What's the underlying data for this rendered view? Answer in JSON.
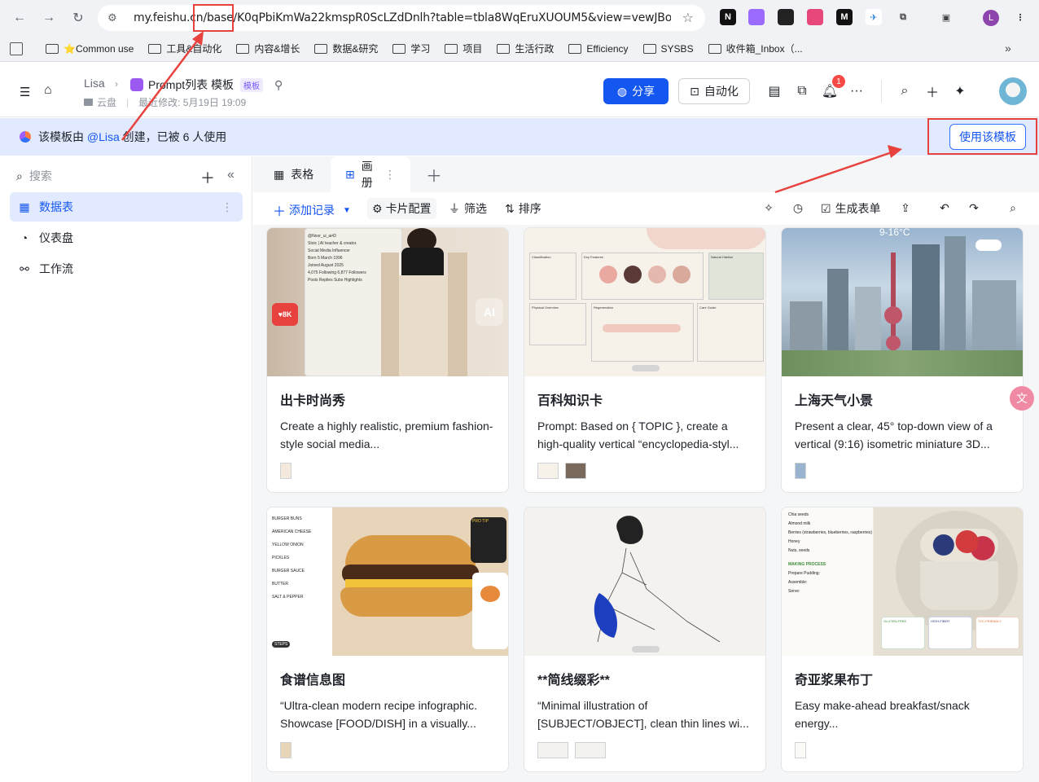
{
  "browser": {
    "url": "my.feishu.cn/base/K0qPbiKmWa22kmspR0ScLZdDnlh?table=tbla8WqEruXUOUM5&view=vewJBof...",
    "extensions": [
      "N",
      "C",
      "S",
      "M",
      "Y"
    ],
    "profile_initial": "L",
    "bookmarks": [
      "⭐Common use",
      "工具&自动化",
      "内容&增长",
      "数据&研究",
      "学习",
      "项目",
      "生活行政",
      "Efficiency",
      "SYSBS",
      "收件箱_Inbox（..."
    ],
    "more_label": "»"
  },
  "header": {
    "breadcrumb_parent": "Lisa",
    "title": "Prompt列表 模板",
    "template_badge": "模板",
    "location": "云盘",
    "last_modified": "最近修改: 5月19日 19:09",
    "share_label": "分享",
    "automation_label": "自动化",
    "notification_count": "1",
    "more_label": "···"
  },
  "banner": {
    "prefix": "该模板由 ",
    "author": "@Lisa",
    "suffix": " 创建，已被 6 人使用",
    "use_template_label": "使用该模板"
  },
  "sidebar": {
    "search_placeholder": "搜索",
    "items": [
      {
        "label": "数据表",
        "active": true
      },
      {
        "label": "仪表盘",
        "active": false
      },
      {
        "label": "工作流",
        "active": false
      }
    ]
  },
  "tabs": [
    {
      "label": "表格",
      "active": false
    },
    {
      "label": "画册",
      "active": true
    }
  ],
  "toolbar": {
    "add_record": "添加记录",
    "card_config": "卡片配置",
    "filter": "筛选",
    "sort": "排序",
    "generate_form": "生成表单"
  },
  "cards": [
    {
      "title": "出卡时尚秀",
      "desc": "Create a highly realistic, premium fashion-style social media...",
      "image_text": [
        "@Noor_ui_ai43",
        "Stoic | AI teacher & creator.",
        "Social Media Influencer",
        "Born 5 March 1996",
        "Joined August 2025",
        "4,075 Following  6,877 Followers",
        "Posts  Replies  Subs  Highlights"
      ],
      "like_count": "8K",
      "thumbs": 1
    },
    {
      "title": "百科知识卡",
      "desc": "Prompt: Based on { TOPIC }, create a high-quality vertical “encyclopedia-styl...",
      "image_text": [
        "Classification",
        "Key Features",
        "Natural Habitat",
        "Physical Overview",
        "Regeneration",
        "Care Guide"
      ],
      "thumbs": 2
    },
    {
      "title": "上海天气小景",
      "desc": "Present a clear, 45° top-down view of a vertical (9:16) isometric miniature 3D...",
      "image_text": [
        "9-16°C"
      ],
      "thumbs": 1
    },
    {
      "title": "食谱信息图",
      "desc": "“Ultra-clean modern recipe infographic. Showcase [FOOD/DISH] in a visually...",
      "image_text": [
        "BURGER BUNS",
        "AMERICAN CHEESE",
        "YELLOW ONION",
        "PICKLES",
        "BURGER SAUCE",
        "BUTTER",
        "SALT & PEPPER",
        "PRO TIP",
        "STEPS"
      ],
      "thumbs": 1
    },
    {
      "title": "**简线缀彩**",
      "desc": "“Minimal illustration of [SUBJECT/OBJECT], clean thin lines wi...",
      "image_text": [],
      "thumbs": 2
    },
    {
      "title": "奇亚浆果布丁",
      "desc": "Easy make-ahead breakfast/snack energy...",
      "image_text": [
        "Chia seeds",
        "Almond milk",
        "Berries (strawberries, blueberries, raspberries)",
        "Honey",
        "Nuts, seeds",
        "MAKING PROCESS",
        "Prepare Pudding:",
        "Assemble:",
        "Serve:",
        "GLUTEN-FREE",
        "HIGH-FIBER",
        "TYC-FRIENDLY"
      ],
      "thumbs": 1
    }
  ],
  "colors": {
    "brand_blue": "#1456f0",
    "banner_bg": "#e1eaff",
    "annotation_red": "#e8423f"
  }
}
